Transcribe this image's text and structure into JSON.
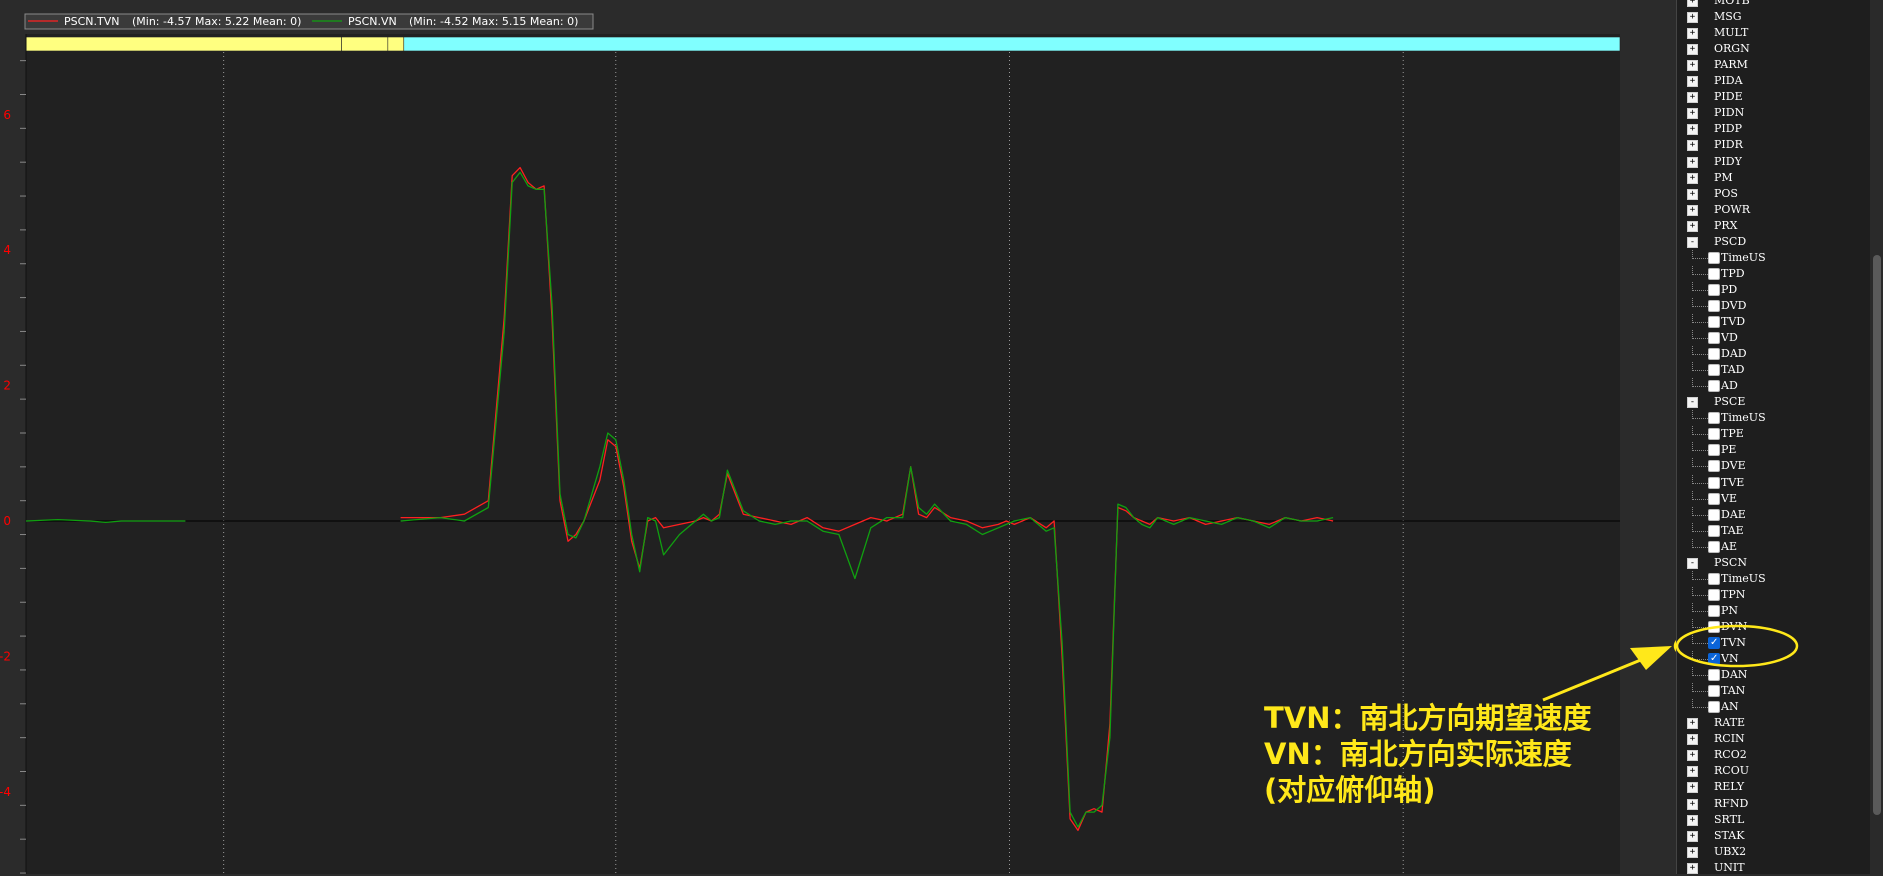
{
  "legend": [
    {
      "name": "PSCN.TVN",
      "stats": "(Min: -4.57 Max: 5.22 Mean: 0)",
      "color": "#ff2020"
    },
    {
      "name": "PSCN.VN",
      "stats": "(Min: -4.52 Max: 5.15 Mean: 0)",
      "color": "#10a010"
    }
  ],
  "chart_data": {
    "type": "line",
    "ylim": [
      -5.2,
      7.0
    ],
    "yticks": [
      "6",
      "4",
      "2",
      "0",
      "-2",
      "-4"
    ],
    "ytick_values": [
      6,
      4,
      2,
      0,
      -2,
      -4
    ],
    "grid": "vertical dotted",
    "colors": {
      "background": "#212121",
      "mode_bar_yellow": "#ffff80",
      "mode_bar_cyan": "#80ffff",
      "zero_line": "#000000"
    },
    "mode_bar": [
      {
        "color": "#ffff80",
        "from": 0.0,
        "to": 0.198
      },
      {
        "color": "#ffff80",
        "from": 0.198,
        "to": 0.227
      },
      {
        "color": "#ffff80",
        "from": 0.227,
        "to": 0.237
      },
      {
        "color": "#80ffff",
        "from": 0.237,
        "to": 1.0
      }
    ],
    "x_range": [
      0,
      1
    ],
    "series": [
      {
        "name": "PSCN.TVN",
        "color": "#ff2020",
        "x": [
          0.0,
          0.02,
          0.04,
          0.05,
          0.06,
          0.074,
          0.1,
          0.2,
          0.22,
          0.235,
          0.26,
          0.275,
          0.29,
          0.3,
          0.305,
          0.31,
          0.315,
          0.32,
          0.325,
          0.33,
          0.335,
          0.34,
          0.345,
          0.35,
          0.36,
          0.365,
          0.37,
          0.375,
          0.38,
          0.385,
          0.39,
          0.395,
          0.4,
          0.41,
          0.42,
          0.425,
          0.43,
          0.435,
          0.44,
          0.45,
          0.46,
          0.47,
          0.48,
          0.49,
          0.5,
          0.51,
          0.52,
          0.53,
          0.54,
          0.55,
          0.555,
          0.56,
          0.565,
          0.57,
          0.58,
          0.59,
          0.6,
          0.61,
          0.615,
          0.62,
          0.63,
          0.64,
          0.645,
          0.65,
          0.655,
          0.66,
          0.665,
          0.67,
          0.675,
          0.68,
          0.685,
          0.69,
          0.695,
          0.7,
          0.705,
          0.71,
          0.72,
          0.73,
          0.74,
          0.75,
          0.76,
          0.77,
          0.78,
          0.79,
          0.8,
          0.81,
          0.82,
          0.83,
          0.84,
          0.85,
          0.86,
          0.87,
          0.88
        ],
        "y": [
          null,
          null,
          null,
          null,
          null,
          null,
          null,
          null,
          null,
          0.05,
          0.05,
          0.1,
          0.3,
          3.0,
          5.1,
          5.22,
          5.0,
          4.9,
          4.95,
          3.0,
          0.3,
          -0.3,
          -0.2,
          0.0,
          0.6,
          1.2,
          1.1,
          0.5,
          -0.3,
          -0.7,
          0.0,
          0.05,
          -0.1,
          -0.05,
          0.0,
          0.05,
          0.0,
          0.1,
          0.7,
          0.1,
          0.05,
          0.0,
          -0.05,
          0.05,
          -0.1,
          -0.15,
          -0.05,
          0.05,
          0.0,
          0.1,
          0.8,
          0.1,
          0.05,
          0.2,
          0.05,
          0.0,
          -0.1,
          -0.05,
          0.0,
          -0.05,
          0.05,
          -0.1,
          0.0,
          -2.0,
          -4.4,
          -4.57,
          -4.3,
          -4.25,
          -4.3,
          -3.0,
          0.2,
          0.15,
          0.05,
          0.0,
          -0.05,
          0.05,
          0.0,
          0.05,
          -0.05,
          0.0,
          0.05,
          0.0,
          -0.05,
          0.05,
          0.0,
          0.05,
          0.0,
          null,
          null,
          null,
          null,
          null,
          null
        ]
      },
      {
        "name": "PSCN.VN",
        "color": "#10a010",
        "x": [
          0.0,
          0.02,
          0.04,
          0.05,
          0.06,
          0.074,
          0.1,
          0.2,
          0.22,
          0.235,
          0.26,
          0.275,
          0.29,
          0.3,
          0.305,
          0.31,
          0.315,
          0.32,
          0.325,
          0.33,
          0.335,
          0.34,
          0.345,
          0.35,
          0.36,
          0.365,
          0.37,
          0.375,
          0.38,
          0.385,
          0.39,
          0.395,
          0.4,
          0.41,
          0.42,
          0.425,
          0.43,
          0.435,
          0.44,
          0.45,
          0.46,
          0.47,
          0.48,
          0.49,
          0.5,
          0.51,
          0.52,
          0.53,
          0.54,
          0.55,
          0.555,
          0.56,
          0.565,
          0.57,
          0.58,
          0.59,
          0.6,
          0.61,
          0.615,
          0.62,
          0.63,
          0.64,
          0.645,
          0.65,
          0.655,
          0.66,
          0.665,
          0.67,
          0.675,
          0.68,
          0.685,
          0.69,
          0.695,
          0.7,
          0.705,
          0.71,
          0.72,
          0.73,
          0.74,
          0.75,
          0.76,
          0.77,
          0.78,
          0.79,
          0.8,
          0.81,
          0.82,
          0.83,
          0.84,
          0.85,
          0.86,
          0.87,
          0.88
        ],
        "y": [
          0.0,
          0.02,
          0.0,
          -0.02,
          0.0,
          0.0,
          0.0,
          null,
          null,
          0.0,
          0.05,
          0.0,
          0.2,
          2.8,
          5.0,
          5.15,
          4.95,
          4.9,
          4.9,
          3.2,
          0.4,
          -0.2,
          -0.25,
          0.0,
          0.8,
          1.3,
          1.2,
          0.6,
          -0.2,
          -0.75,
          0.05,
          0.0,
          -0.5,
          -0.2,
          0.0,
          0.1,
          0.0,
          0.05,
          0.75,
          0.15,
          0.0,
          -0.05,
          0.0,
          0.0,
          -0.15,
          -0.2,
          -0.85,
          -0.1,
          0.05,
          0.05,
          0.8,
          0.2,
          0.1,
          0.25,
          0.0,
          -0.05,
          -0.2,
          -0.1,
          -0.05,
          0.0,
          0.05,
          -0.15,
          -0.1,
          -1.8,
          -4.3,
          -4.52,
          -4.3,
          -4.3,
          -4.2,
          -3.2,
          0.25,
          0.2,
          0.05,
          -0.05,
          -0.1,
          0.05,
          -0.05,
          0.05,
          0.0,
          -0.05,
          0.05,
          0.0,
          -0.1,
          0.05,
          0.0,
          0.0,
          0.05,
          null,
          null,
          null,
          null,
          null,
          null
        ]
      }
    ]
  },
  "tree": {
    "items": [
      {
        "label": "MOTB",
        "level": 0,
        "expander": "+"
      },
      {
        "label": "MSG",
        "level": 0,
        "expander": "+"
      },
      {
        "label": "MULT",
        "level": 0,
        "expander": "+"
      },
      {
        "label": "ORGN",
        "level": 0,
        "expander": "+"
      },
      {
        "label": "PARM",
        "level": 0,
        "expander": "+"
      },
      {
        "label": "PIDA",
        "level": 0,
        "expander": "+"
      },
      {
        "label": "PIDE",
        "level": 0,
        "expander": "+"
      },
      {
        "label": "PIDN",
        "level": 0,
        "expander": "+"
      },
      {
        "label": "PIDP",
        "level": 0,
        "expander": "+"
      },
      {
        "label": "PIDR",
        "level": 0,
        "expander": "+"
      },
      {
        "label": "PIDY",
        "level": 0,
        "expander": "+"
      },
      {
        "label": "PM",
        "level": 0,
        "expander": "+"
      },
      {
        "label": "POS",
        "level": 0,
        "expander": "+"
      },
      {
        "label": "POWR",
        "level": 0,
        "expander": "+"
      },
      {
        "label": "PRX",
        "level": 0,
        "expander": "+"
      },
      {
        "label": "PSCD",
        "level": 0,
        "expander": "-"
      },
      {
        "label": "TimeUS",
        "level": 1,
        "checked": false
      },
      {
        "label": "TPD",
        "level": 1,
        "checked": false
      },
      {
        "label": "PD",
        "level": 1,
        "checked": false
      },
      {
        "label": "DVD",
        "level": 1,
        "checked": false
      },
      {
        "label": "TVD",
        "level": 1,
        "checked": false
      },
      {
        "label": "VD",
        "level": 1,
        "checked": false
      },
      {
        "label": "DAD",
        "level": 1,
        "checked": false
      },
      {
        "label": "TAD",
        "level": 1,
        "checked": false
      },
      {
        "label": "AD",
        "level": 1,
        "checked": false
      },
      {
        "label": "PSCE",
        "level": 0,
        "expander": "-"
      },
      {
        "label": "TimeUS",
        "level": 1,
        "checked": false
      },
      {
        "label": "TPE",
        "level": 1,
        "checked": false
      },
      {
        "label": "PE",
        "level": 1,
        "checked": false
      },
      {
        "label": "DVE",
        "level": 1,
        "checked": false
      },
      {
        "label": "TVE",
        "level": 1,
        "checked": false
      },
      {
        "label": "VE",
        "level": 1,
        "checked": false
      },
      {
        "label": "DAE",
        "level": 1,
        "checked": false
      },
      {
        "label": "TAE",
        "level": 1,
        "checked": false
      },
      {
        "label": "AE",
        "level": 1,
        "checked": false
      },
      {
        "label": "PSCN",
        "level": 0,
        "expander": "-"
      },
      {
        "label": "TimeUS",
        "level": 1,
        "checked": false
      },
      {
        "label": "TPN",
        "level": 1,
        "checked": false
      },
      {
        "label": "PN",
        "level": 1,
        "checked": false
      },
      {
        "label": "DVN",
        "level": 1,
        "checked": false
      },
      {
        "label": "TVN",
        "level": 1,
        "checked": true
      },
      {
        "label": "VN",
        "level": 1,
        "checked": true
      },
      {
        "label": "DAN",
        "level": 1,
        "checked": false
      },
      {
        "label": "TAN",
        "level": 1,
        "checked": false
      },
      {
        "label": "AN",
        "level": 1,
        "checked": false
      },
      {
        "label": "RATE",
        "level": 0,
        "expander": "+"
      },
      {
        "label": "RCIN",
        "level": 0,
        "expander": "+"
      },
      {
        "label": "RCO2",
        "level": 0,
        "expander": "+"
      },
      {
        "label": "RCOU",
        "level": 0,
        "expander": "+"
      },
      {
        "label": "RELY",
        "level": 0,
        "expander": "+"
      },
      {
        "label": "RFND",
        "level": 0,
        "expander": "+"
      },
      {
        "label": "SRTL",
        "level": 0,
        "expander": "+"
      },
      {
        "label": "STAK",
        "level": 0,
        "expander": "+"
      },
      {
        "label": "UBX2",
        "level": 0,
        "expander": "+"
      },
      {
        "label": "UNIT",
        "level": 0,
        "expander": "+"
      }
    ]
  },
  "annotation": {
    "line1": "TVN：南北方向期望速度",
    "line2": "VN：南北方向实际速度",
    "line3": "(对应俯仰轴)",
    "color": "#ffe81a"
  }
}
